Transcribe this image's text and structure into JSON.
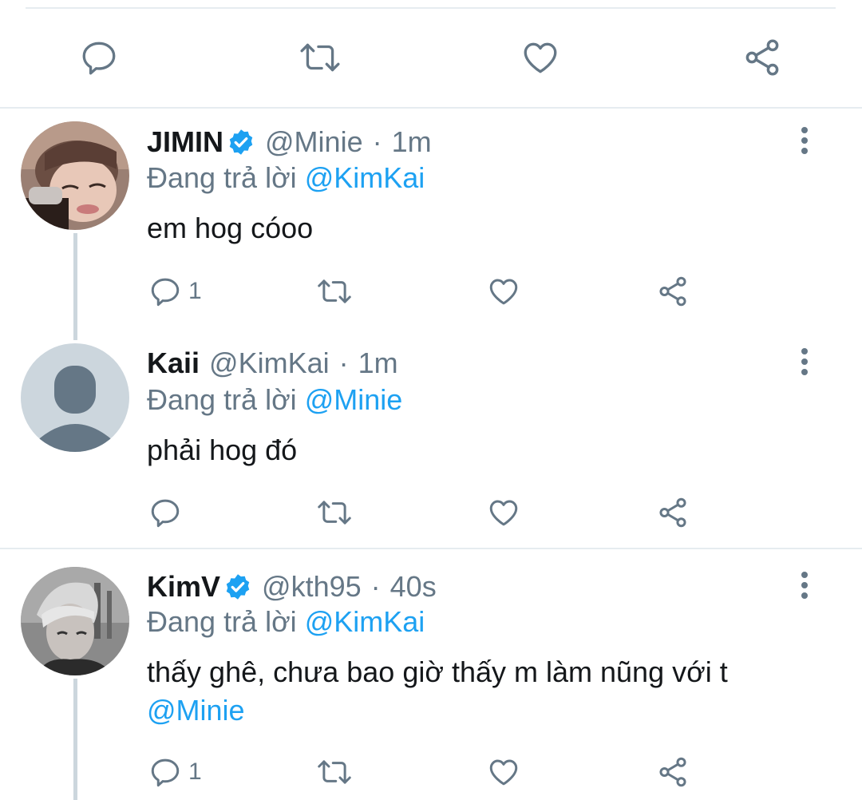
{
  "colors": {
    "accent": "#1da1f2",
    "secondary": "#657786",
    "text": "#14171a",
    "divider": "#e6ecf0",
    "thread_line": "#ccd6dd"
  },
  "icons": {
    "reply": "reply-icon",
    "retweet": "retweet-icon",
    "like": "heart-icon",
    "share": "share-icon",
    "more": "more-vertical-icon",
    "verified": "verified-badge-icon"
  },
  "replying_label": "Đang trả lời",
  "tweets": [
    {
      "name": "JIMIN",
      "verified": true,
      "handle": "@Minie",
      "separator": "·",
      "time": "1m",
      "replying_to": "@KimKai",
      "text": "em hog cóoo",
      "reply_count": "1"
    },
    {
      "name": "Kaii",
      "verified": false,
      "handle": "@KimKai",
      "separator": "·",
      "time": "1m",
      "replying_to": "@Minie",
      "text": "phải hog đó",
      "reply_count": ""
    },
    {
      "name": "KimV",
      "verified": true,
      "handle": "@kth95",
      "separator": "·",
      "time": "40s",
      "replying_to": "@KimKai",
      "text": "thấy ghê, chưa bao giờ thấy m làm nũng với t",
      "text_mention": "@Minie",
      "reply_count": "1"
    }
  ]
}
